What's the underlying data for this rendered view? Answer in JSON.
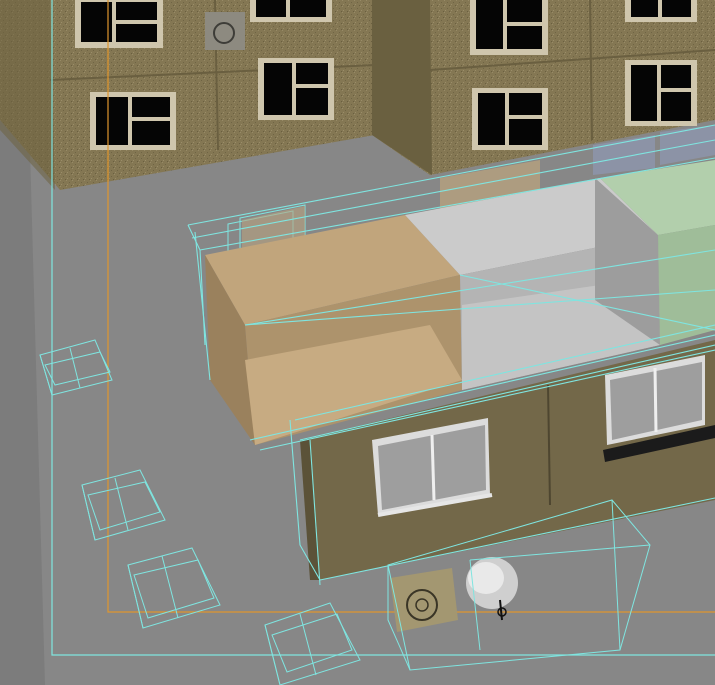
{
  "viewport": {
    "name": "3d-perspective-viewport",
    "background": "#7b7b7b",
    "ground": "#898989",
    "selection_wire_color": "#7fe5e0",
    "safe_frame_color": "#e0962e",
    "facade_color": "#847753",
    "facade_dark": "#6d623f",
    "window_frame": "#cfc6ad",
    "window_glass": "#050505",
    "module_tan": "#b59a72",
    "module_grey": "#c2c2c2",
    "module_green": "#a9c7a3",
    "wall_front": "#6f6447"
  }
}
